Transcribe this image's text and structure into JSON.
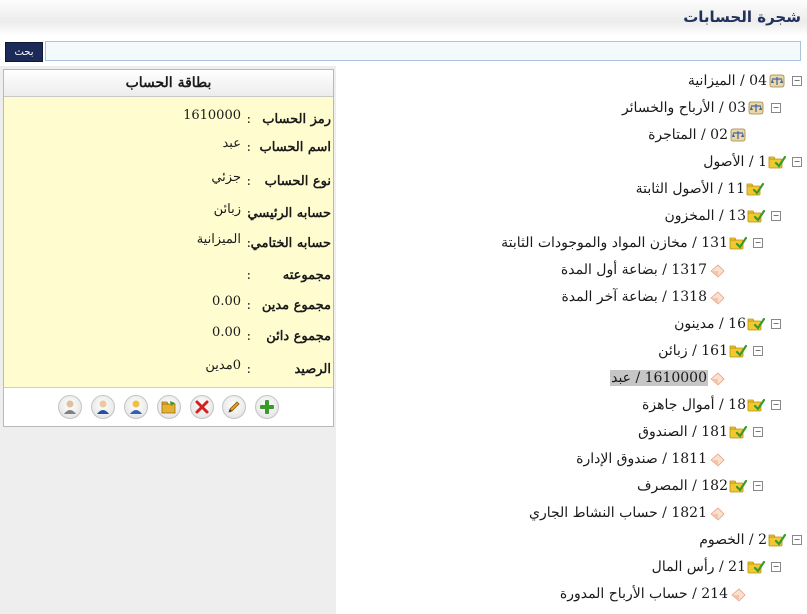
{
  "header": {
    "title": "شجرة الحسابات"
  },
  "search": {
    "button_label": "بحث",
    "placeholder": ""
  },
  "card": {
    "title": "بطاقة الحساب",
    "fields": [
      {
        "label": "رمز الحساب",
        "value": "1610000"
      },
      {
        "label": "اسم الحساب",
        "value": "عبد"
      },
      {
        "label": "نوع الحساب",
        "value": "جزئي"
      },
      {
        "label": "حسابه الرئيسي",
        "value": "زبائن"
      },
      {
        "label": "حسابه الختامي",
        "value": "الميزانية"
      },
      {
        "label": "مجموعته",
        "value": ""
      },
      {
        "label": "مجموع مدين",
        "value": "0.00"
      },
      {
        "label": "مجموع دائن",
        "value": "0.00"
      },
      {
        "label": "الرصيد",
        "value": "0مدين"
      }
    ],
    "toolbar": [
      {
        "name": "add-icon"
      },
      {
        "name": "edit-icon"
      },
      {
        "name": "delete-icon"
      },
      {
        "name": "open-folder-icon"
      },
      {
        "name": "user-yellow-icon"
      },
      {
        "name": "user-blue-icon"
      },
      {
        "name": "user-gray-icon"
      }
    ]
  },
  "tree": {
    "nodes": [
      {
        "label": "04 / الميزانية",
        "icon": "scale-icon",
        "toggle": "−"
      },
      {
        "label": "03 / الأرباح والخسائر",
        "icon": "scale-icon",
        "toggle": "−"
      },
      {
        "label": "02 / المتاجرة",
        "icon": "scale-icon",
        "toggle": ""
      },
      {
        "label": "1 / الأصول",
        "icon": "folder-check-icon",
        "toggle": "−"
      },
      {
        "label": "11 / الأصول الثابتة",
        "icon": "folder-check-icon",
        "toggle": ""
      },
      {
        "label": "13 / المخزون",
        "icon": "folder-check-icon",
        "toggle": "−"
      },
      {
        "label": "131 / مخازن المواد والموجودات الثابتة",
        "icon": "folder-check-icon",
        "toggle": "−"
      },
      {
        "label": "1317 / بضاعة أول المدة",
        "icon": "leaf-icon",
        "toggle": ""
      },
      {
        "label": "1318 / بضاعة آخر المدة",
        "icon": "leaf-icon",
        "toggle": ""
      },
      {
        "label": "16 / مدينون",
        "icon": "folder-check-icon",
        "toggle": "−"
      },
      {
        "label": "161 / زبائن",
        "icon": "folder-check-icon",
        "toggle": "−"
      },
      {
        "label": "1610000 / عبد",
        "icon": "leaf-icon",
        "toggle": ""
      },
      {
        "label": "18 / أموال جاهزة",
        "icon": "folder-check-icon",
        "toggle": "−"
      },
      {
        "label": "181 / الصندوق",
        "icon": "folder-check-icon",
        "toggle": "−"
      },
      {
        "label": "1811 / صندوق الإدارة",
        "icon": "leaf-icon",
        "toggle": ""
      },
      {
        "label": "182 / المصرف",
        "icon": "folder-check-icon",
        "toggle": "−"
      },
      {
        "label": "1821 / حساب النشاط الجاري",
        "icon": "leaf-icon",
        "toggle": ""
      },
      {
        "label": "2 / الخصوم",
        "icon": "folder-check-icon",
        "toggle": "−"
      },
      {
        "label": "21 / رأس المال",
        "icon": "folder-check-icon",
        "toggle": "−"
      },
      {
        "label": "214 / حساب الأرباح المدورة",
        "icon": "leaf-icon",
        "toggle": ""
      }
    ]
  },
  "colors": {
    "accent": "#1c2a58",
    "card_bg": "#fffdd0",
    "selected_bg": "#c6c6c6"
  }
}
